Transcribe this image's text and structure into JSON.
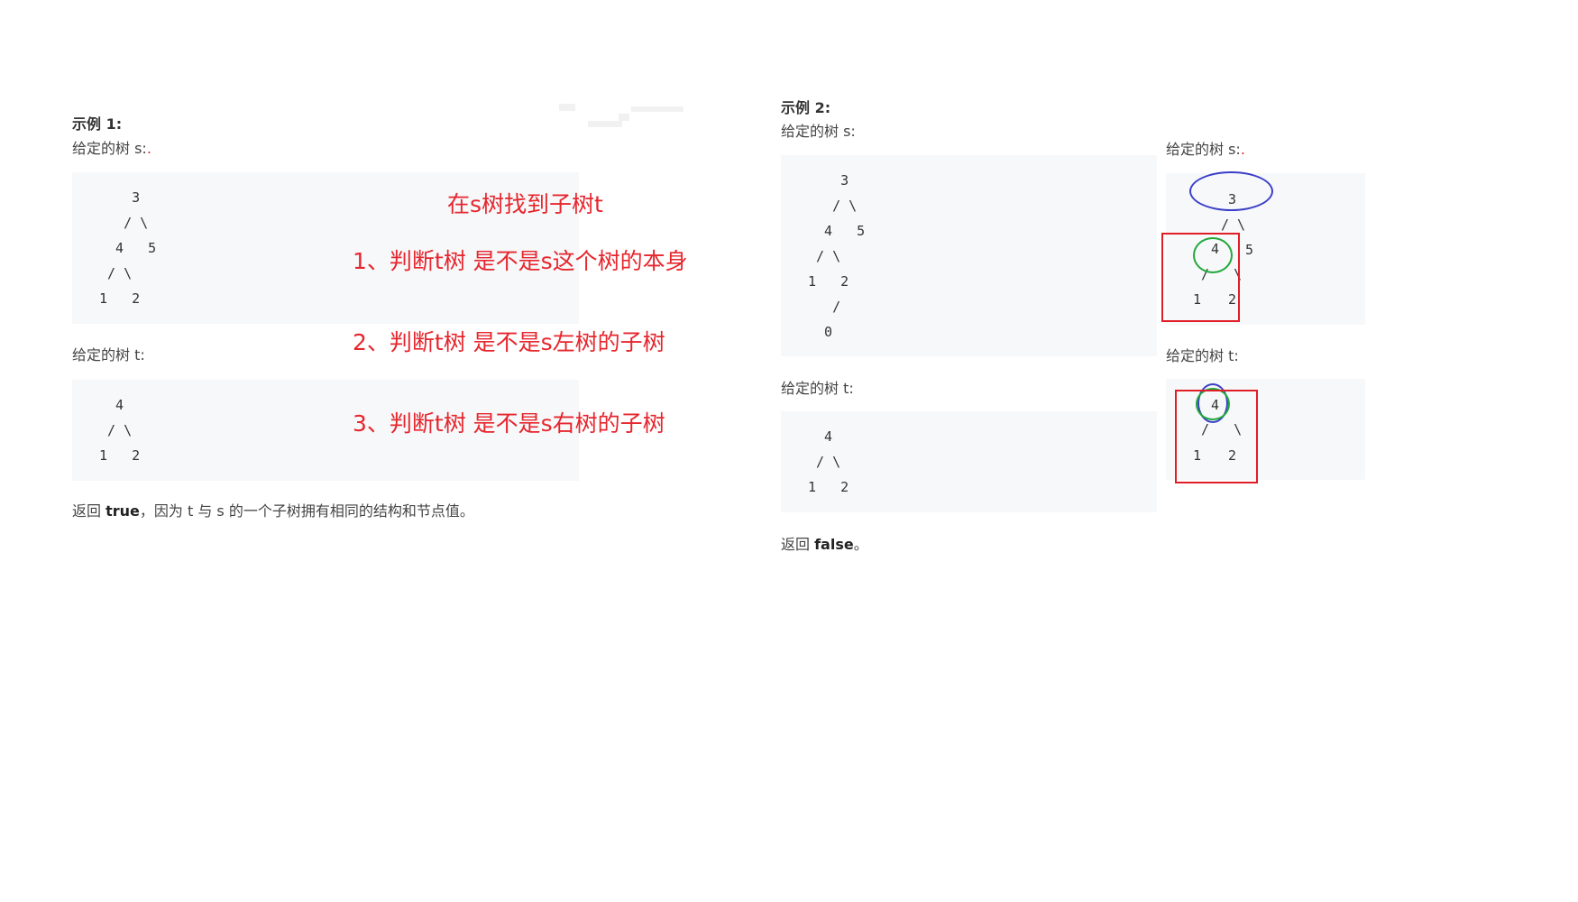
{
  "example1": {
    "heading": "示例 1:",
    "s_label": "给定的树 s:",
    "s_tree": "    3\n   / \\\n  4   5\n / \\\n1   2",
    "t_label": "给定的树 t:",
    "t_tree": "  4\n / \\\n1   2",
    "result_prefix": "返回 ",
    "result_bold": "true",
    "result_suffix": "，因为 t 与 s 的一个子树拥有相同的结构和节点值。"
  },
  "annotations": {
    "title": "在s树找到子树t",
    "step1": "1、判断t树 是不是s这个树的本身",
    "step2": "2、判断t树 是不是s左树的子树",
    "step3": "3、判断t树 是不是s右树的子树"
  },
  "example2": {
    "heading": "示例 2:",
    "s_label": "给定的树 s:",
    "s_tree": "    3\n   / \\\n  4   5\n / \\\n1   2\n   /\n  0",
    "t_label": "给定的树 t:",
    "t_tree": "  4\n / \\\n1   2",
    "result_prefix": "返回 ",
    "result_bold": "false",
    "result_suffix": "。"
  },
  "diagram": {
    "s_label": "给定的树 s:",
    "s_nodes": {
      "root": "3",
      "left": "4",
      "right": "5",
      "ll": "1",
      "lr": "2",
      "edge_root": "/ \\",
      "edge_left": "/   \\"
    },
    "t_label": "给定的树 t:",
    "t_nodes": {
      "root": "4",
      "ll": "1",
      "lr": "2",
      "edge": "/   \\"
    }
  },
  "colors": {
    "red": "#e6262d",
    "blue": "#3a3fc8",
    "green": "#23a83a",
    "code_bg": "#f7f8fa"
  }
}
